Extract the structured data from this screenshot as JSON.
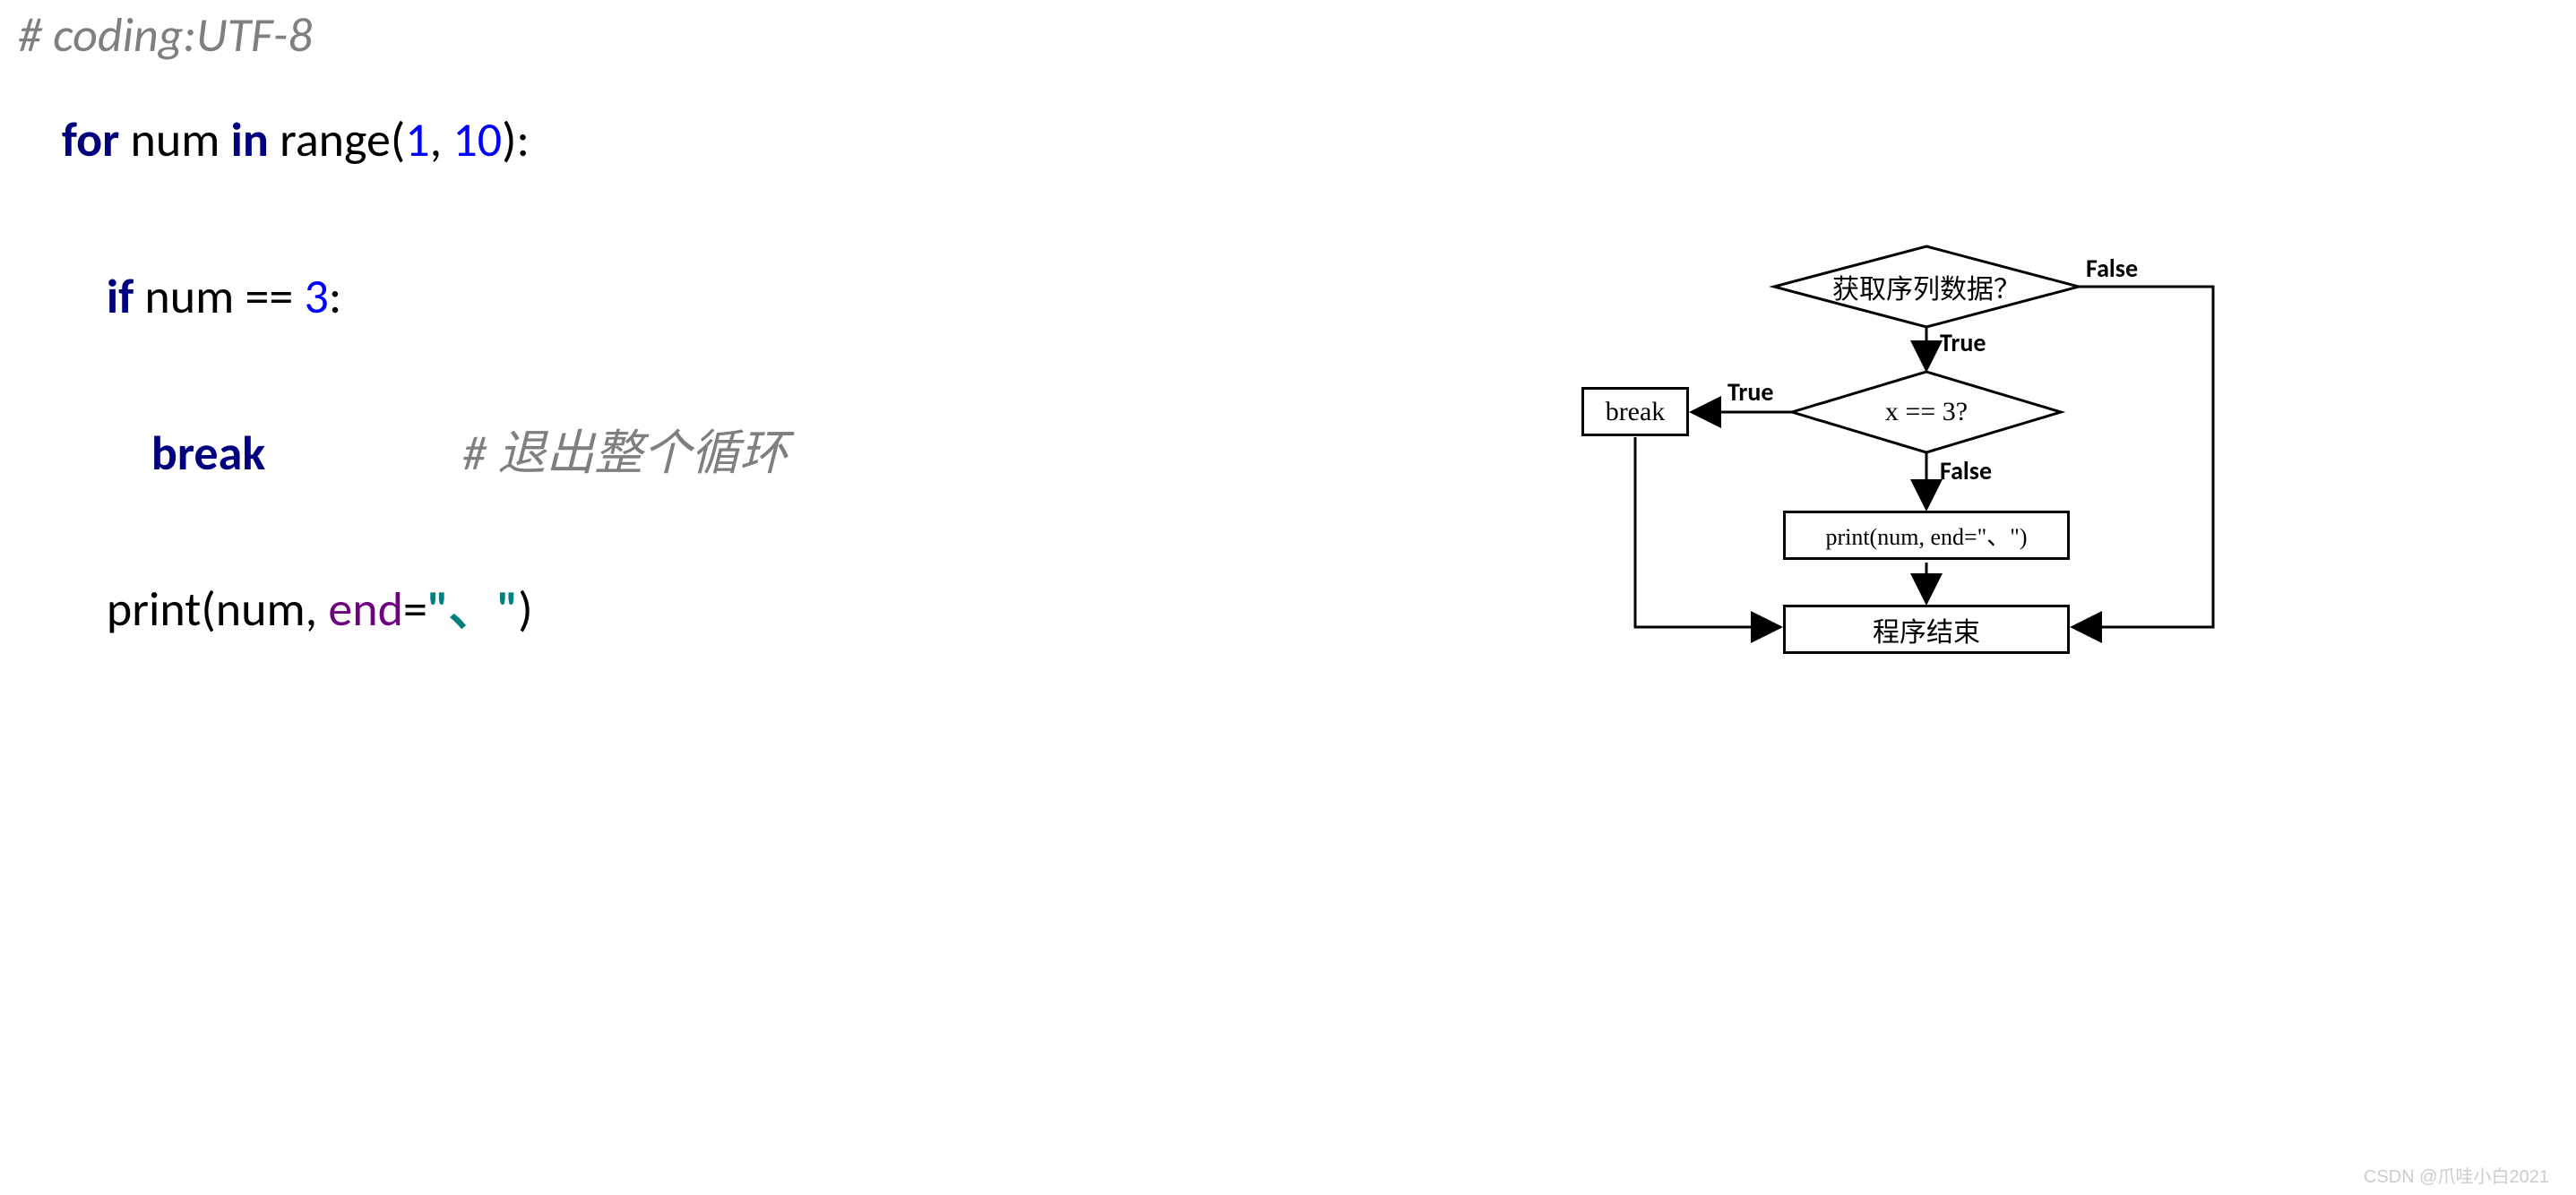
{
  "code": {
    "line1_comment": "# coding:UTF-8",
    "line2_for": "for",
    "line2_var": " num ",
    "line2_in": "in",
    "line2_range": " range(",
    "line2_n1": "1",
    "line2_comma": ", ",
    "line2_n2": "10",
    "line2_close": "):",
    "line3_if": "if",
    "line3_cond": " num == ",
    "line3_val": "3",
    "line3_colon": ":",
    "line4_break": "break",
    "line4_comment": "# 退出整个循环",
    "line5_print": "print(num, ",
    "line5_end": "end",
    "line5_eq": "=",
    "line5_str": "\"、\"",
    "line5_close": ")"
  },
  "flow": {
    "diamond1": "获取序列数据？",
    "diamond2": "x == 3?",
    "rect_break": "break",
    "rect_print": "print(num, end=\"、\")",
    "rect_end": "程序结束",
    "label_true": "True",
    "label_false": "False"
  },
  "watermark": "CSDN @爪哇小白2021"
}
